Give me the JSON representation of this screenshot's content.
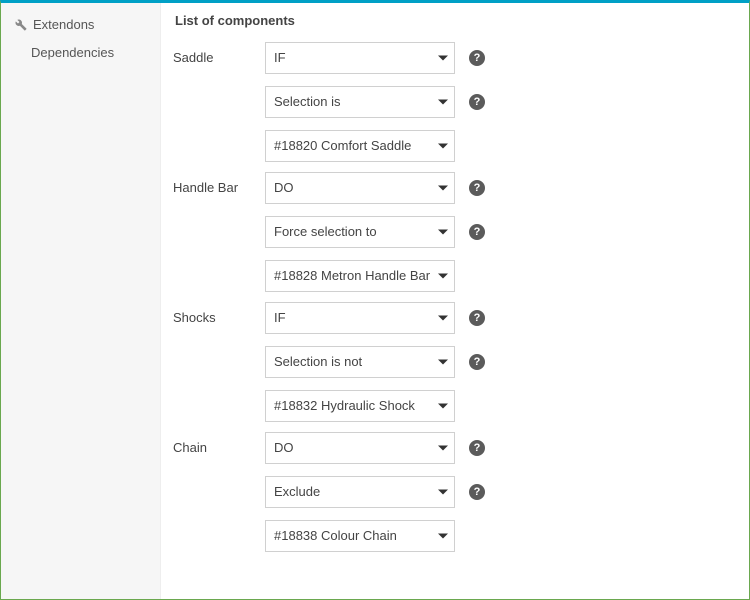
{
  "sidebar": {
    "items": [
      {
        "label": "Extendons"
      },
      {
        "label": "Dependencies"
      }
    ]
  },
  "section_title": "List of components",
  "components": [
    {
      "label": "Saddle",
      "selects": [
        {
          "value": "IF",
          "help": true
        },
        {
          "value": "Selection is",
          "help": true
        },
        {
          "value": "#18820 Comfort Saddle",
          "help": false
        }
      ]
    },
    {
      "label": "Handle Bar",
      "selects": [
        {
          "value": "DO",
          "help": true
        },
        {
          "value": "Force selection to",
          "help": true
        },
        {
          "value": "#18828 Metron Handle Bar",
          "help": false
        }
      ]
    },
    {
      "label": "Shocks",
      "selects": [
        {
          "value": "IF",
          "help": true
        },
        {
          "value": "Selection is not",
          "help": true
        },
        {
          "value": "#18832 Hydraulic Shock",
          "help": false
        }
      ]
    },
    {
      "label": "Chain",
      "selects": [
        {
          "value": "DO",
          "help": true
        },
        {
          "value": "Exclude",
          "help": true
        },
        {
          "value": "#18838 Colour Chain",
          "help": false
        }
      ]
    }
  ]
}
